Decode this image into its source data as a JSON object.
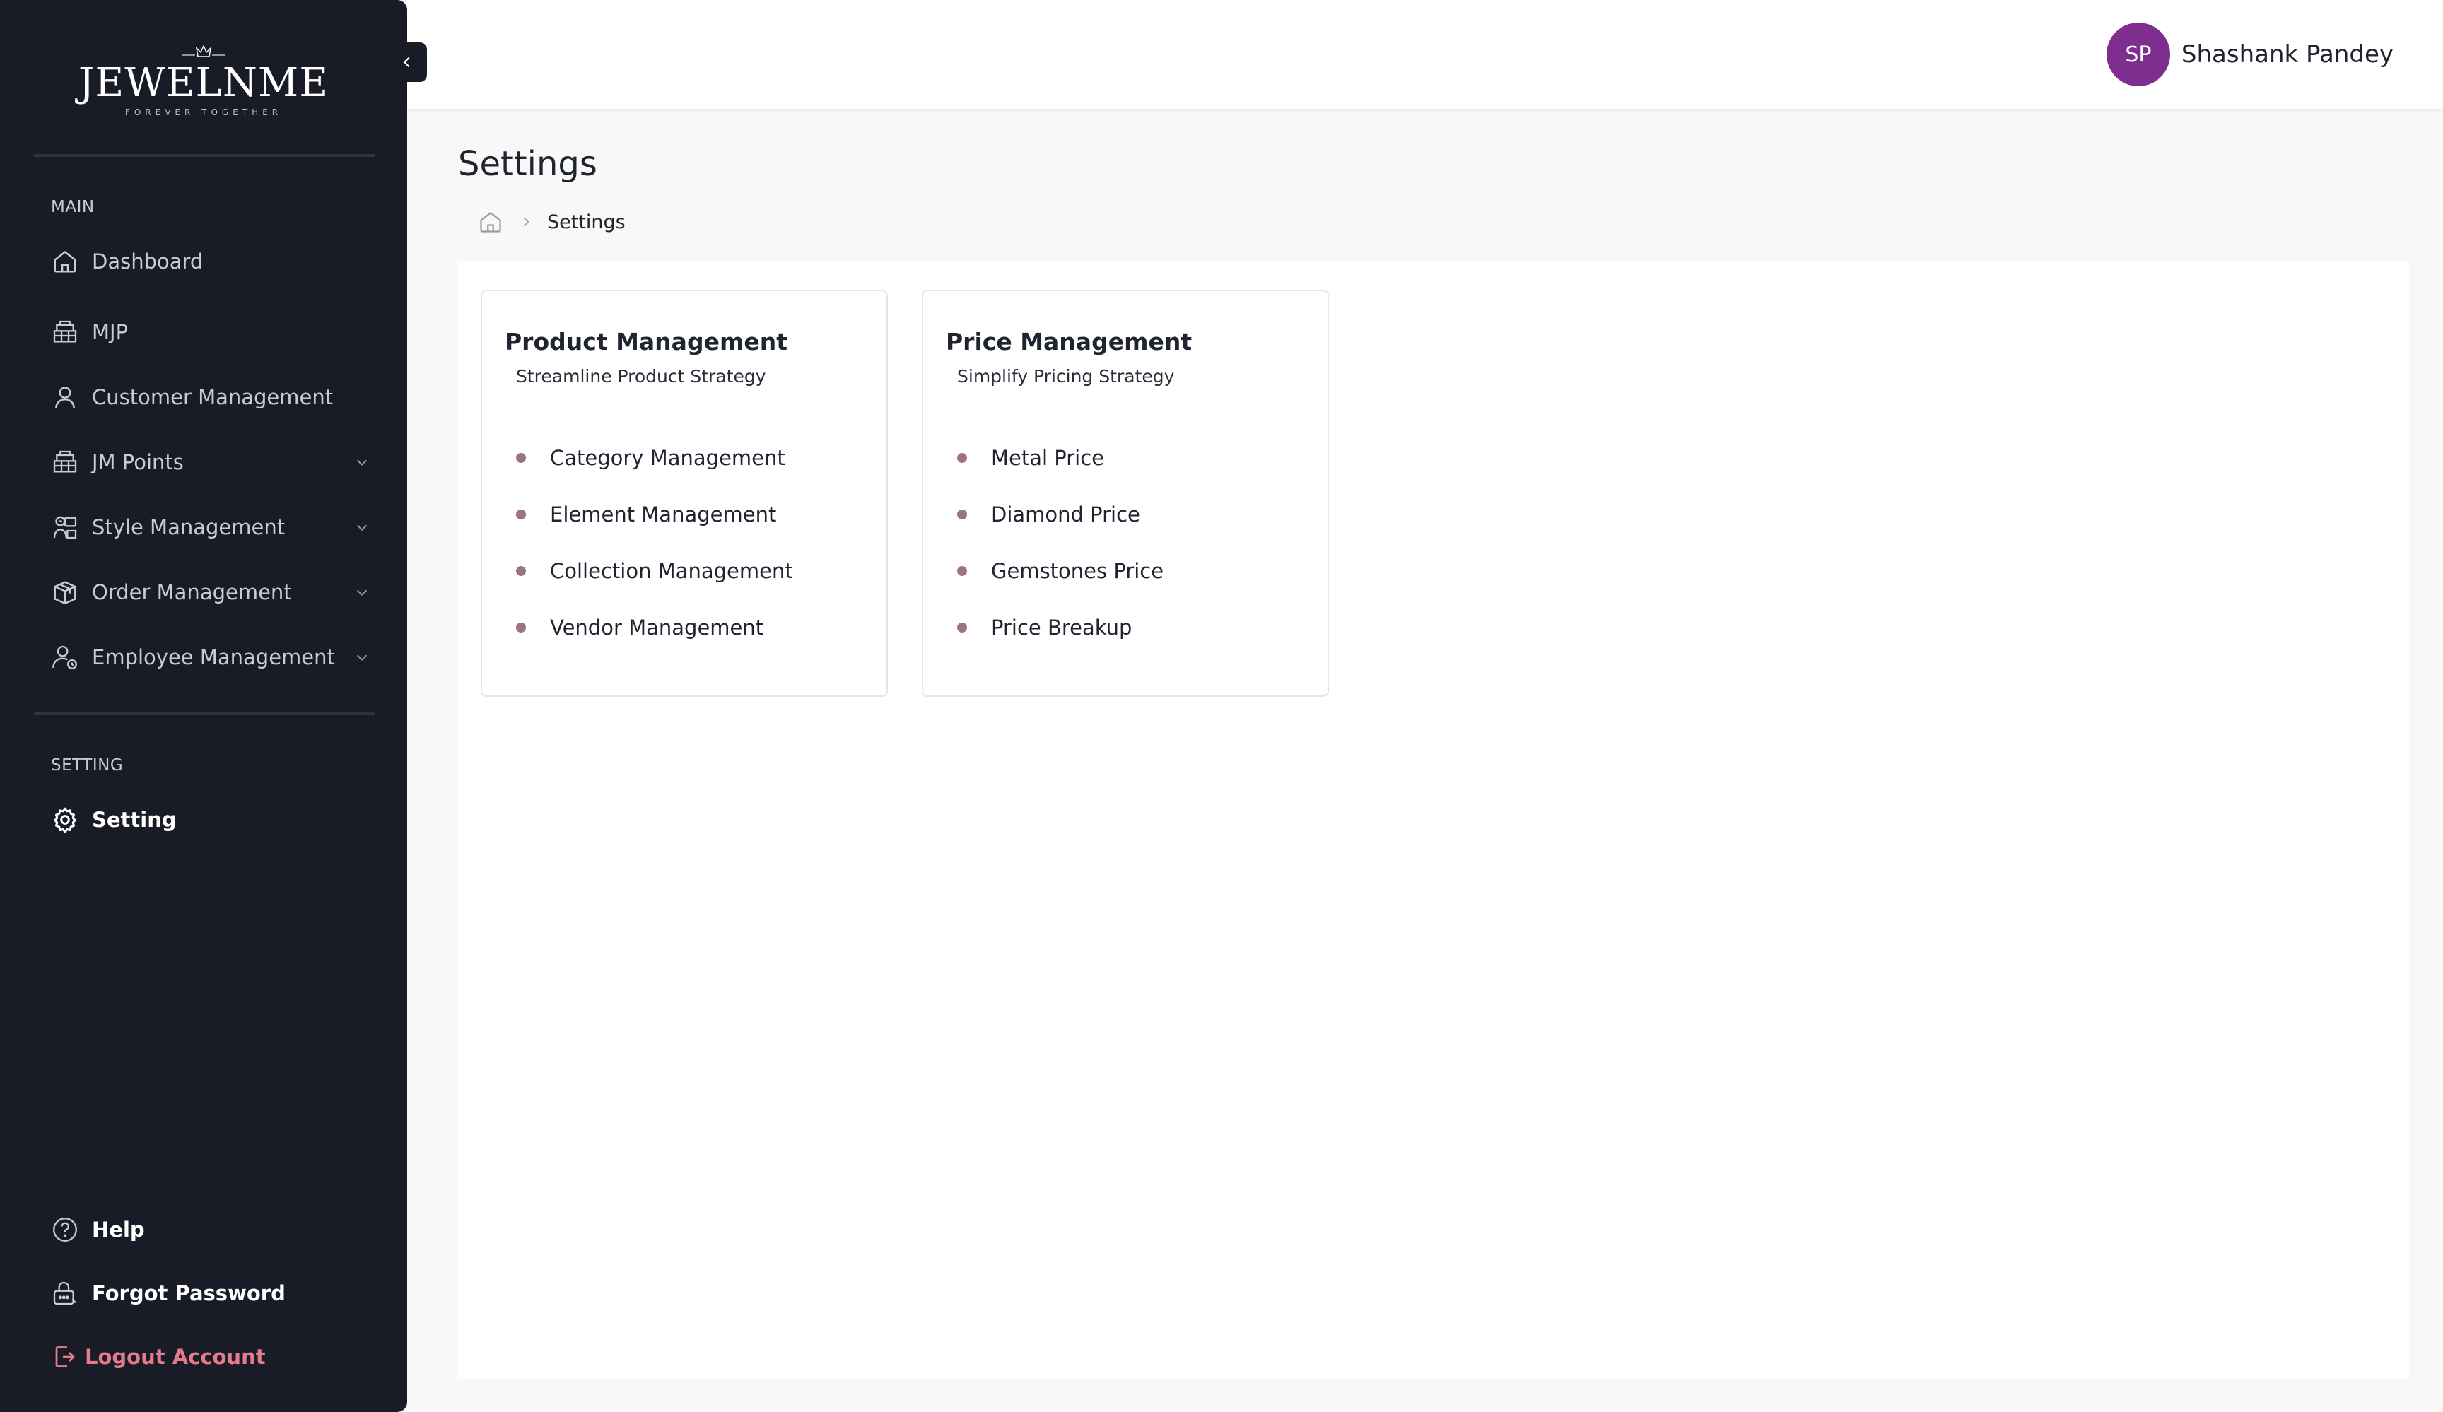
{
  "brand": {
    "name": "JEWELNME",
    "tagline": "FOREVER TOGETHER"
  },
  "colors": {
    "sidebar_bg": "#191c26",
    "accent_logout": "#e37b8b",
    "avatar_bg": "#7d2e8e",
    "bullet": "#9c7380"
  },
  "sidebar": {
    "main_label": "MAIN",
    "setting_label": "SETTING",
    "items": [
      {
        "label": "Dashboard",
        "icon": "home-icon"
      },
      {
        "label": "MJP",
        "icon": "store-icon"
      },
      {
        "label": "Customer Management",
        "icon": "user-icon"
      },
      {
        "label": "JM Points",
        "icon": "store-icon",
        "expandable": true
      },
      {
        "label": "Style Management",
        "icon": "style-icon",
        "expandable": true
      },
      {
        "label": "Order Management",
        "icon": "box-icon",
        "expandable": true
      },
      {
        "label": "Employee Management",
        "icon": "employee-icon",
        "expandable": true
      }
    ],
    "setting_item": {
      "label": "Setting",
      "icon": "gear-icon"
    },
    "footer": [
      {
        "label": "Help",
        "icon": "help-icon"
      },
      {
        "label": "Forgot Password",
        "icon": "lock-icon"
      },
      {
        "label": "Logout Account",
        "icon": "logout-icon"
      }
    ]
  },
  "header": {
    "user_initials": "SP",
    "user_name": "Shashank Pandey"
  },
  "page": {
    "title": "Settings",
    "breadcrumb": [
      "Settings"
    ]
  },
  "cards": [
    {
      "title": "Product Management",
      "subtitle": "Streamline Product Strategy",
      "items": [
        "Category Management",
        "Element Management",
        "Collection Management",
        "Vendor Management"
      ]
    },
    {
      "title": "Price Management",
      "subtitle": "Simplify Pricing Strategy",
      "items": [
        "Metal Price",
        "Diamond Price",
        "Gemstones Price",
        "Price Breakup"
      ]
    }
  ]
}
